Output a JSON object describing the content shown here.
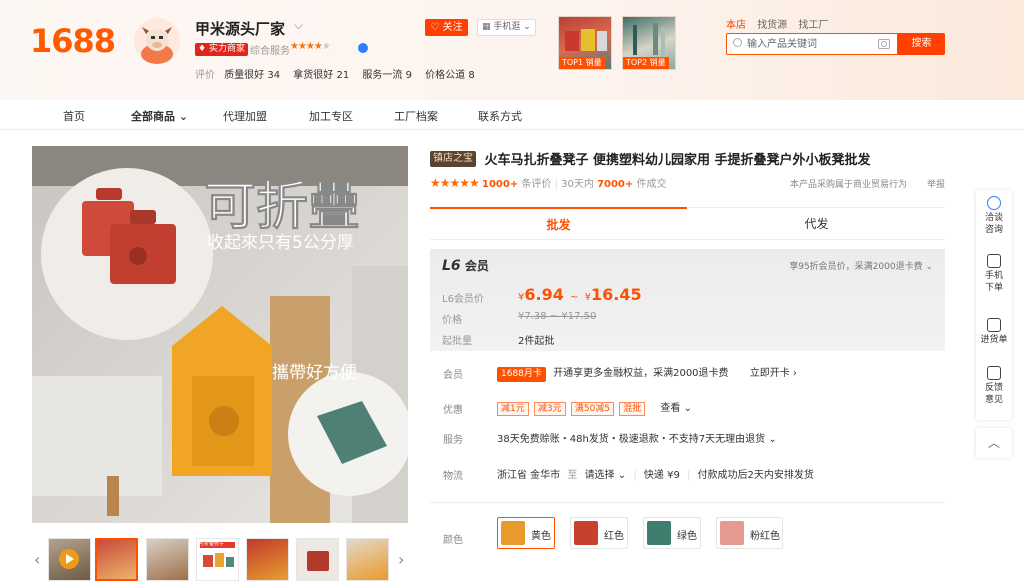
{
  "header": {
    "logo": "1688",
    "shop_name": "甲米源头厂家",
    "strength_badge": "实力商家",
    "service_label": "综合服务",
    "ratings_label": "评价",
    "ratings": [
      {
        "label": "质量很好",
        "count": "34"
      },
      {
        "label": "拿货很好",
        "count": "21"
      },
      {
        "label": "服务一流",
        "count": "9"
      },
      {
        "label": "价格公道",
        "count": "8"
      }
    ],
    "follow_label": "关注",
    "mobile_label": "手机逛",
    "top_products": [
      {
        "tag": "TOP1 销量"
      },
      {
        "tag": "TOP2 销量"
      }
    ]
  },
  "search": {
    "tabs": [
      "本店",
      "找货源",
      "找工厂"
    ],
    "placeholder": "输入产品关键词",
    "button_label": "搜索"
  },
  "nav": {
    "items": [
      "首页",
      "全部商品",
      "代理加盟",
      "加工专区",
      "工厂档案",
      "联系方式"
    ]
  },
  "gallery": {
    "main_headline": "可折疊",
    "main_subline": "收起來只有5公分厚",
    "main_caption": "攜帶好方便",
    "thumb_ad_label": "可折叠凳子"
  },
  "product": {
    "badge": "镇店之宝",
    "title": "火车马扎折叠凳子 便携塑料幼儿园家用 手提折叠凳户外小板凳批发",
    "reviews_count": "1000+",
    "reviews_suffix": "条评价",
    "sales_prefix": "30天内",
    "sales_count": "7000+",
    "sales_suffix": "件成交",
    "trade_note": "本产品采购属于商业贸易行为",
    "report": "举报"
  },
  "tabs": {
    "wholesale": "批发",
    "dropship": "代发"
  },
  "price": {
    "level": "L6",
    "level_suffix": "会员",
    "member_discount": "享95折会员价，采满2000退卡费",
    "member_label": "L6会员价",
    "currency": "¥",
    "low": "6.94",
    "high": "16.45",
    "range_sep": "~",
    "orig_label": "价格",
    "orig_range": "¥7.38 ~ ¥17.50",
    "moq_label": "起批量",
    "moq_value": "2件起批"
  },
  "details": {
    "member_label": "会员",
    "member_card": "1688月卡",
    "member_text": "开通享更多金融权益，采满2000退卡费",
    "member_link": "立即开卡",
    "promo_label": "优惠",
    "coupons": [
      "减1元",
      "减3元",
      "满50减5",
      "混批"
    ],
    "promo_more": "查看",
    "service_label": "服务",
    "service_text": "38天免费赊账・48h发货・极速退款・不支持7天无理由退货",
    "logistics_label": "物流",
    "logistics_from": "浙江省 金华市",
    "logistics_to_label": "至",
    "logistics_select": "请选择",
    "logistics_express": "快递",
    "logistics_fee": "¥9",
    "logistics_ship": "付款成功后2天内安排发货",
    "color_label": "颜色",
    "colors": [
      {
        "name": "黄色",
        "swatch": "#e89a2c"
      },
      {
        "name": "红色",
        "swatch": "#c8402e"
      },
      {
        "name": "绿色",
        "swatch": "#3f7d6e"
      },
      {
        "name": "粉红色",
        "swatch": "#e59a8f"
      }
    ]
  },
  "rail": {
    "items": [
      {
        "label": "洽谈咨询",
        "icon": "chat-icon"
      },
      {
        "label": "手机下单",
        "icon": "qrcode-icon"
      },
      {
        "label": "进货单",
        "icon": "cart-list-icon"
      },
      {
        "label": "反馈意见",
        "icon": "feedback-icon"
      }
    ]
  },
  "colors": {
    "accent": "#ff5000",
    "brand": "#ff5a00"
  }
}
